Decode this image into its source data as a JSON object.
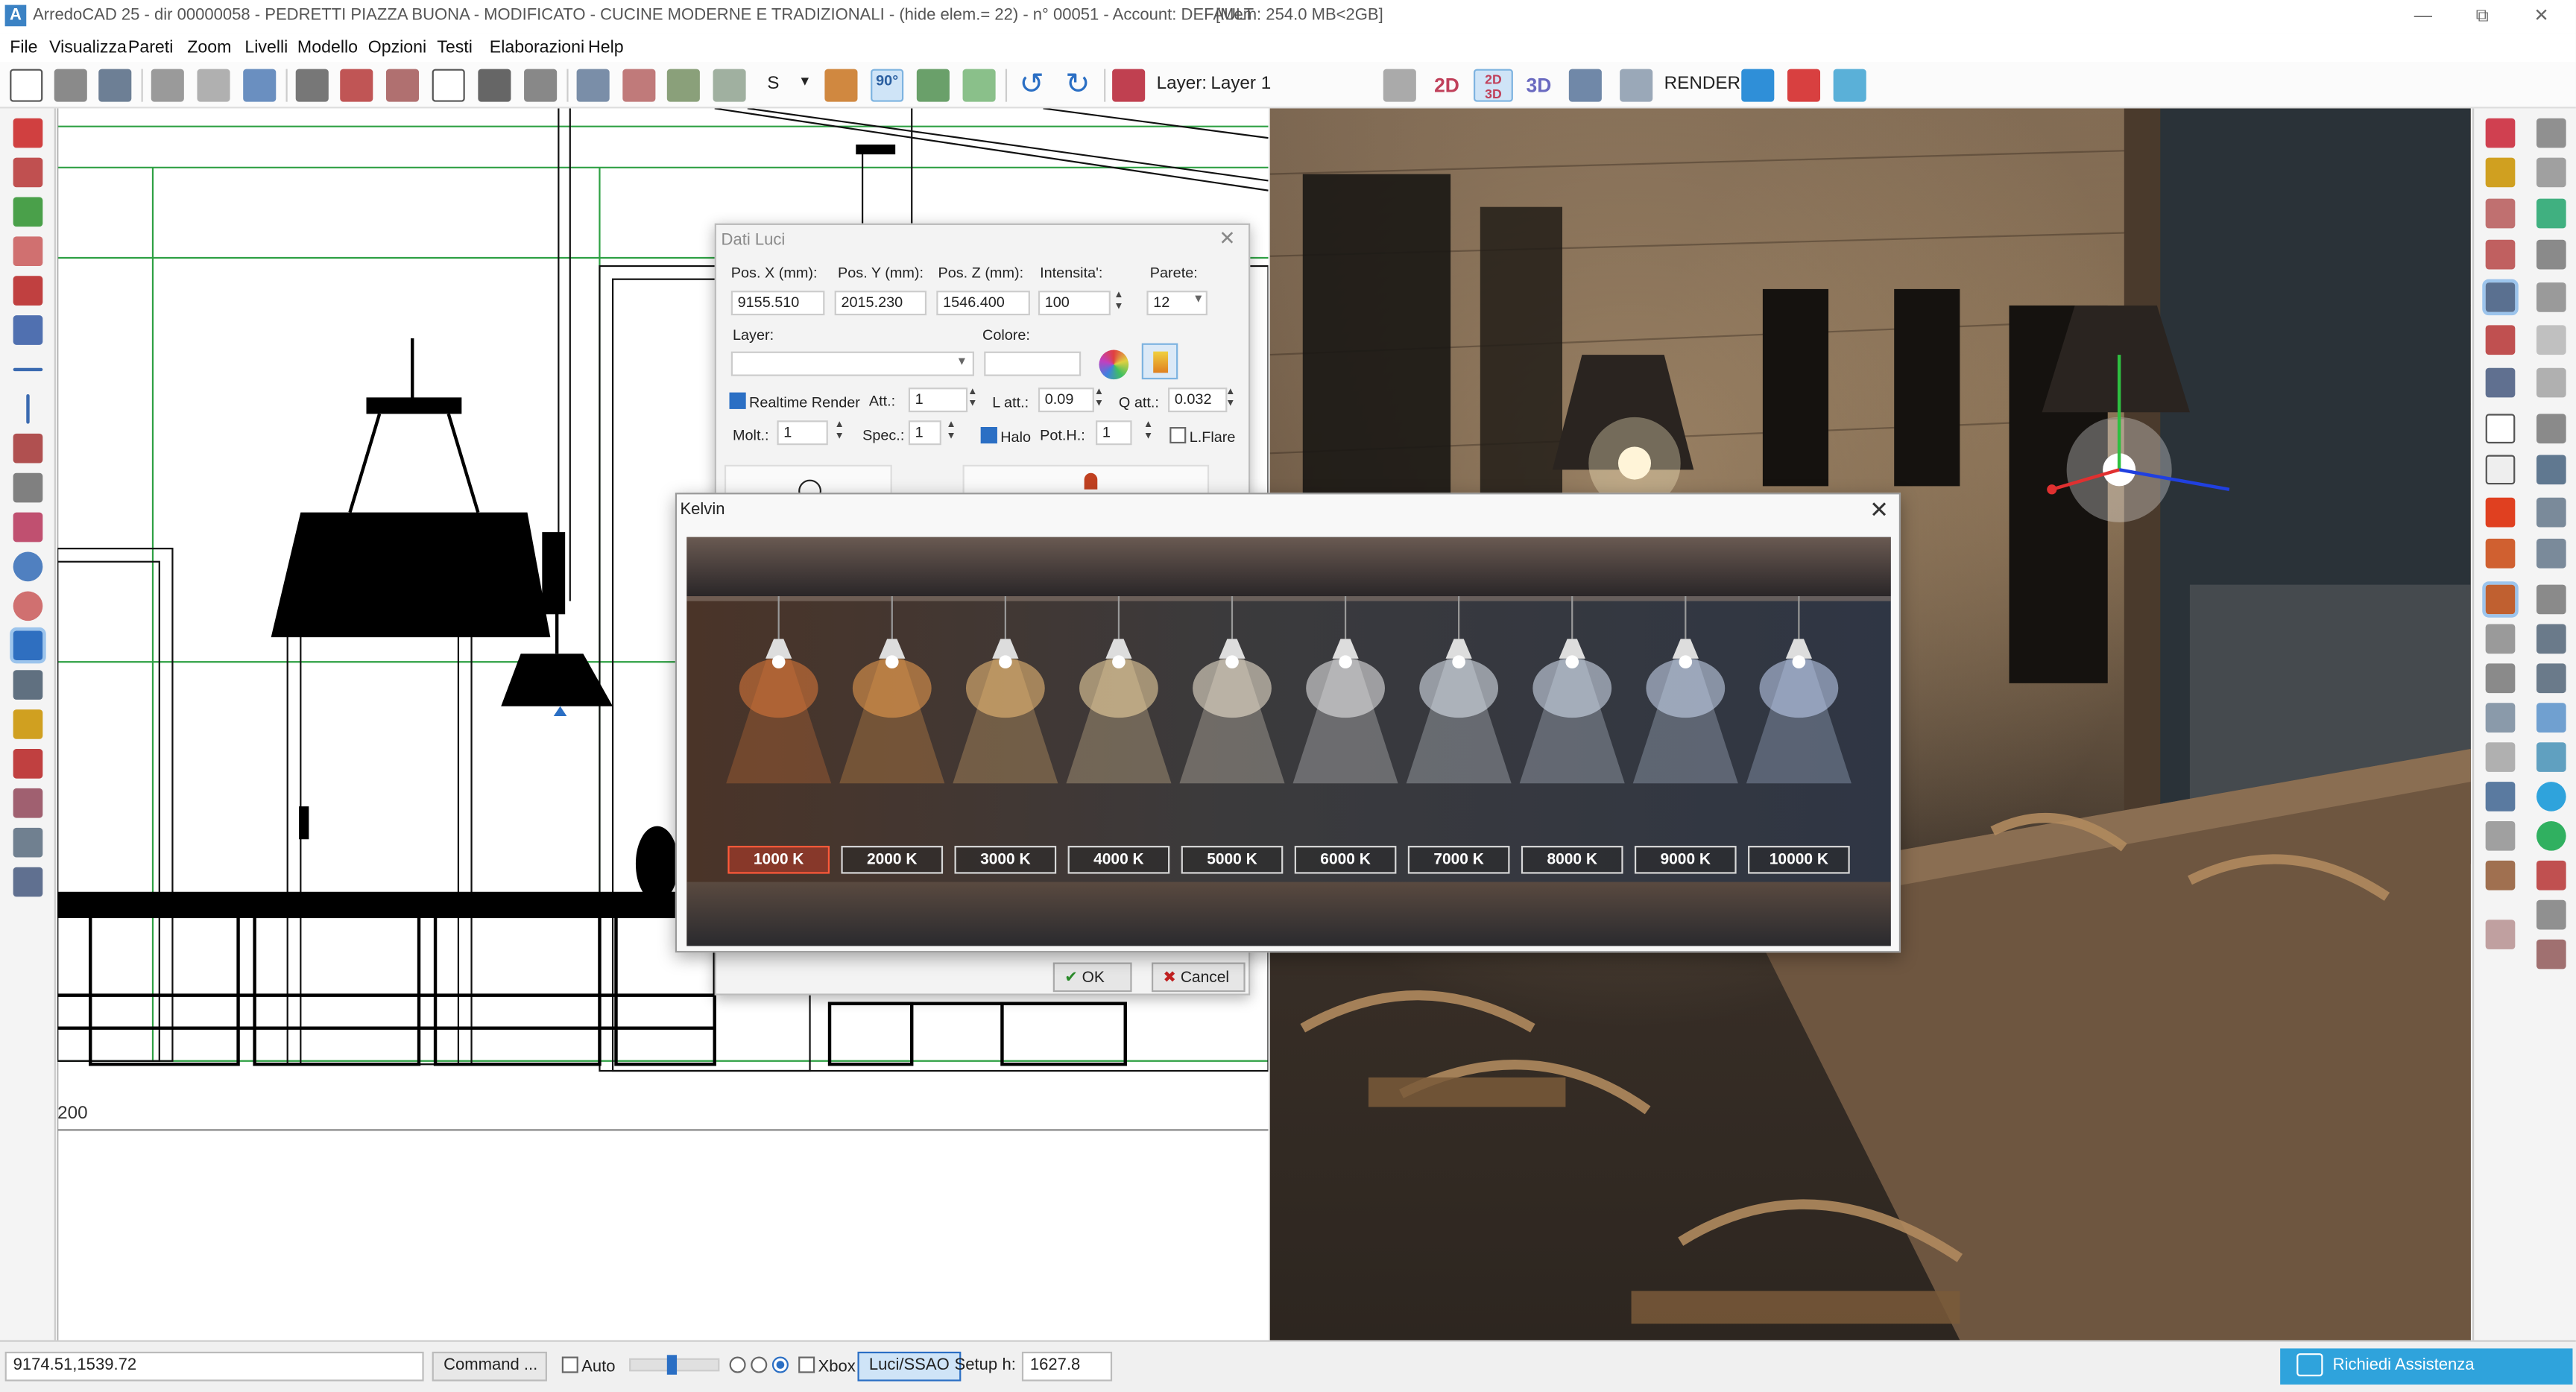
{
  "window": {
    "title": "ArredoCAD 25 - dir 00000058 - PEDRETTI PIAZZA BUONA - MODIFICATO - CUCINE MODERNE E TRADIZIONALI - (hide elem.= 22)  - n° 00051 - Account: DEFAULT",
    "memory": "[Mem: 254.0 MB<2GB]",
    "app_icon": "A"
  },
  "menu": [
    "File",
    "Visualizza",
    "Pareti",
    "Zoom",
    "Livelli",
    "Modello",
    "Opzioni",
    "Testi",
    "Elaborazioni",
    "Help"
  ],
  "toolbar": {
    "s_label": "S",
    "angle_label": "90°",
    "layer_label": "Layer:",
    "layer_value": "Layer 1",
    "view_2d": "2D",
    "view_2d3d": "2D 3D",
    "view_2d3d_top": "2D",
    "view_2d3d_bottom": "3D",
    "view_3d": "3D",
    "render_label": "RENDER"
  },
  "cad": {
    "scale_label": "200"
  },
  "dati_luci": {
    "title": "Dati Luci",
    "pos_x_label": "Pos. X (mm):",
    "pos_x": "9155.510",
    "pos_y_label": "Pos. Y (mm):",
    "pos_y": "2015.230",
    "pos_z_label": "Pos. Z (mm):",
    "pos_z": "1546.400",
    "intensita_label": "Intensita':",
    "intensita": "100",
    "parete_label": "Parete:",
    "parete": "12",
    "layer_label": "Layer:",
    "layer_value": "",
    "colore_label": "Colore:",
    "realtime_label": "Realtime Render",
    "realtime_checked": true,
    "att_label": "Att.:",
    "att": "1",
    "latt_label": "L att.:",
    "latt": "0.09",
    "qatt_label": "Q att.:",
    "qatt": "0.032",
    "molt_label": "Molt.:",
    "molt": "1",
    "spec_label": "Spec.:",
    "spec": "1",
    "halo_label": "Halo",
    "halo_checked": true,
    "poth_label": "Pot.H.:",
    "poth": "1",
    "lflare_label": "L.Flare",
    "lflare_checked": false,
    "ok_label": "OK",
    "cancel_label": "Cancel"
  },
  "kelvin": {
    "title": "Kelvin",
    "options": [
      "1000 K",
      "2000 K",
      "3000 K",
      "4000 K",
      "5000 K",
      "6000 K",
      "7000 K",
      "8000 K",
      "9000 K",
      "10000 K"
    ],
    "selected": "1000 K",
    "light_colors": [
      "#e07a3a",
      "#f0a050",
      "#f6c27a",
      "#f8dca8",
      "#f8ecd8",
      "#f2f2f2",
      "#e6ecf6",
      "#dbe6f6",
      "#d0def6",
      "#c4d6f6"
    ]
  },
  "status": {
    "coords": "9174.51,1539.72",
    "command": "Command ...",
    "auto_label": "Auto",
    "xbox_label": "Xbox",
    "luci_label": "Luci/SSAO",
    "setup_label": "Setup",
    "h_label": "h:",
    "h_value": "1627.8",
    "assist_label": "Richiedi Assistenza"
  },
  "colors": {
    "accent": "#2fa3dc",
    "selected_tool": "#cfe4f7",
    "cad_green": "#2ea043",
    "kelvin_selected_border": "#ff5a3a"
  }
}
